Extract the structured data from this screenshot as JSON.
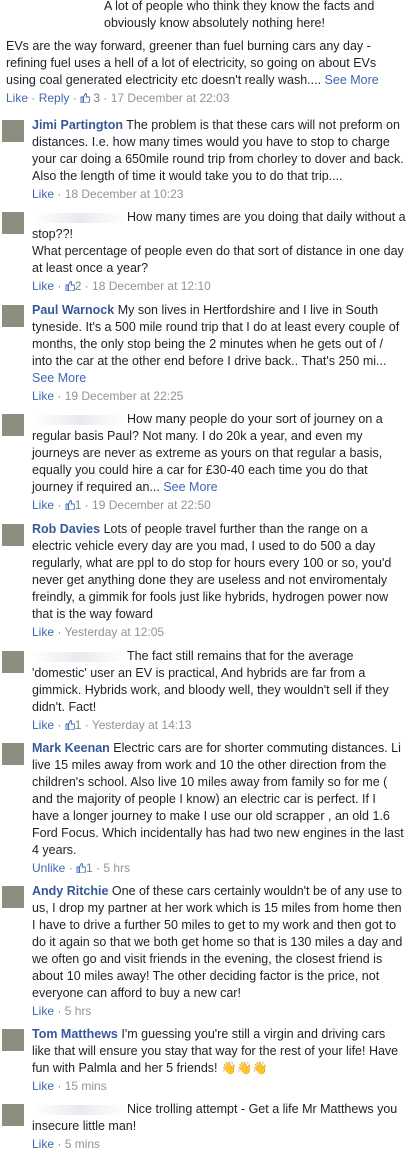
{
  "top": {
    "line1": "A lot of people who think they know the facts and obviously know absolutely nothing here!",
    "line2": "EVs are the way forward, greener than fuel burning cars any day - refining fuel uses a hell of a lot of electricity, so going on about EVs using coal generated electricity etc doesn't really wash....",
    "see_more": "See More",
    "like": "Like",
    "reply": "Reply",
    "likes": "3",
    "time": "17 December at 22:03"
  },
  "comments": [
    {
      "name": "Jimi Partington",
      "text": "The problem is that these cars will not preform on distances. I.e. how many times would you have to stop to charge your car doing a 650mile round trip from chorley to dover and back. Also the length of time it would take you to do that trip....",
      "like": "Like",
      "likes": "",
      "time": "18 December at 10:23"
    },
    {
      "name": "",
      "text": "How many times are you doing that daily without a stop??!\nWhat percentage of people even do that sort of distance in one day at least once a year?",
      "like": "Like",
      "likes": "2",
      "time": "18 December at 12:10"
    },
    {
      "name": "Paul Warnock",
      "text": "My son lives in Hertfordshire and I live in South tyneside. It's a 500 mile round trip that I do at least every couple of months, the only stop being the 2 minutes when he gets out of / into the car at the other end before I drive back.. That's 250 mi...",
      "see_more": "See More",
      "like": "Like",
      "likes": "",
      "time": "19 December at 22:25"
    },
    {
      "name": "",
      "text": "How many people do your sort of journey on a regular basis Paul? Not many. I do 20k a year, and even my journeys are never as extreme as yours on that regular a basis, equally you could hire a car for £30-40 each time you do that journey if required an...",
      "see_more": "See More",
      "like": "Like",
      "likes": "1",
      "time": "19 December at 22:50"
    },
    {
      "name": "Rob Davies",
      "text": "Lots of people travel further than the range on a electric vehicle every day are you mad, I used to do 500 a day regularly, what are ppl to do stop for hours every 100 or so, you'd never get anything done they are useless and not enviromentaly freindly, a gimmik for fools just like hybrids, hydrogen power now that is the way foward",
      "like": "Like",
      "likes": "",
      "time": "Yesterday at 12:05"
    },
    {
      "name": "",
      "text": "The fact still remains that for the average 'domestic' user an EV is practical, And hybrids are far from a gimmick. Hybrids work, and bloody well, they wouldn't sell if they didn't. Fact!",
      "like": "Like",
      "likes": "1",
      "time": "Yesterday at 14:13"
    },
    {
      "name": "Mark Keenan",
      "text": "Electric cars are for shorter commuting distances. Li live 15 miles away from work and 10 the other direction from the children's school. Also live 10 miles away from family so for me ( and the majority of people I know) an electric car is perfect. If I have a longer journey to make I use our old scrapper , an old 1.6 Ford Focus. Which incidentally has had two new engines in the last 4 years.",
      "like": "Unlike",
      "likes": "1",
      "time": "5 hrs"
    },
    {
      "name": "Andy Ritchie",
      "text": "One of these cars certainly wouldn't be of any use to us, I drop my partner at her work which is 15 miles from home then I have to drive a further 50 miles to get to my work and then got to do it again so that we both get home so that is 130 miles a day and we often go and visit friends in the evening, the closest friend is about 10 miles away! The other deciding factor is the price, not everyone can afford to buy a new car!",
      "like": "Like",
      "likes": "",
      "time": "5 hrs"
    },
    {
      "name": "Tom Matthews",
      "text": "I'm guessing you're still a virgin and driving cars like that will ensure you stay that way for the rest of your life! Have fun with Palmla and her 5 friends! 👋👋👋",
      "like": "Like",
      "likes": "",
      "time": "15 mins"
    },
    {
      "name": "",
      "text": "Nice trolling attempt - Get a life Mr Matthews you insecure little man!",
      "like": "Like",
      "likes": "",
      "time": "5 mins"
    }
  ],
  "colors": {
    "name": "#365899",
    "link": "#4267b2",
    "meta": "#90949c"
  },
  "icons": {
    "thumb": "thumbs-up-icon",
    "avatar": "profile-avatar"
  }
}
